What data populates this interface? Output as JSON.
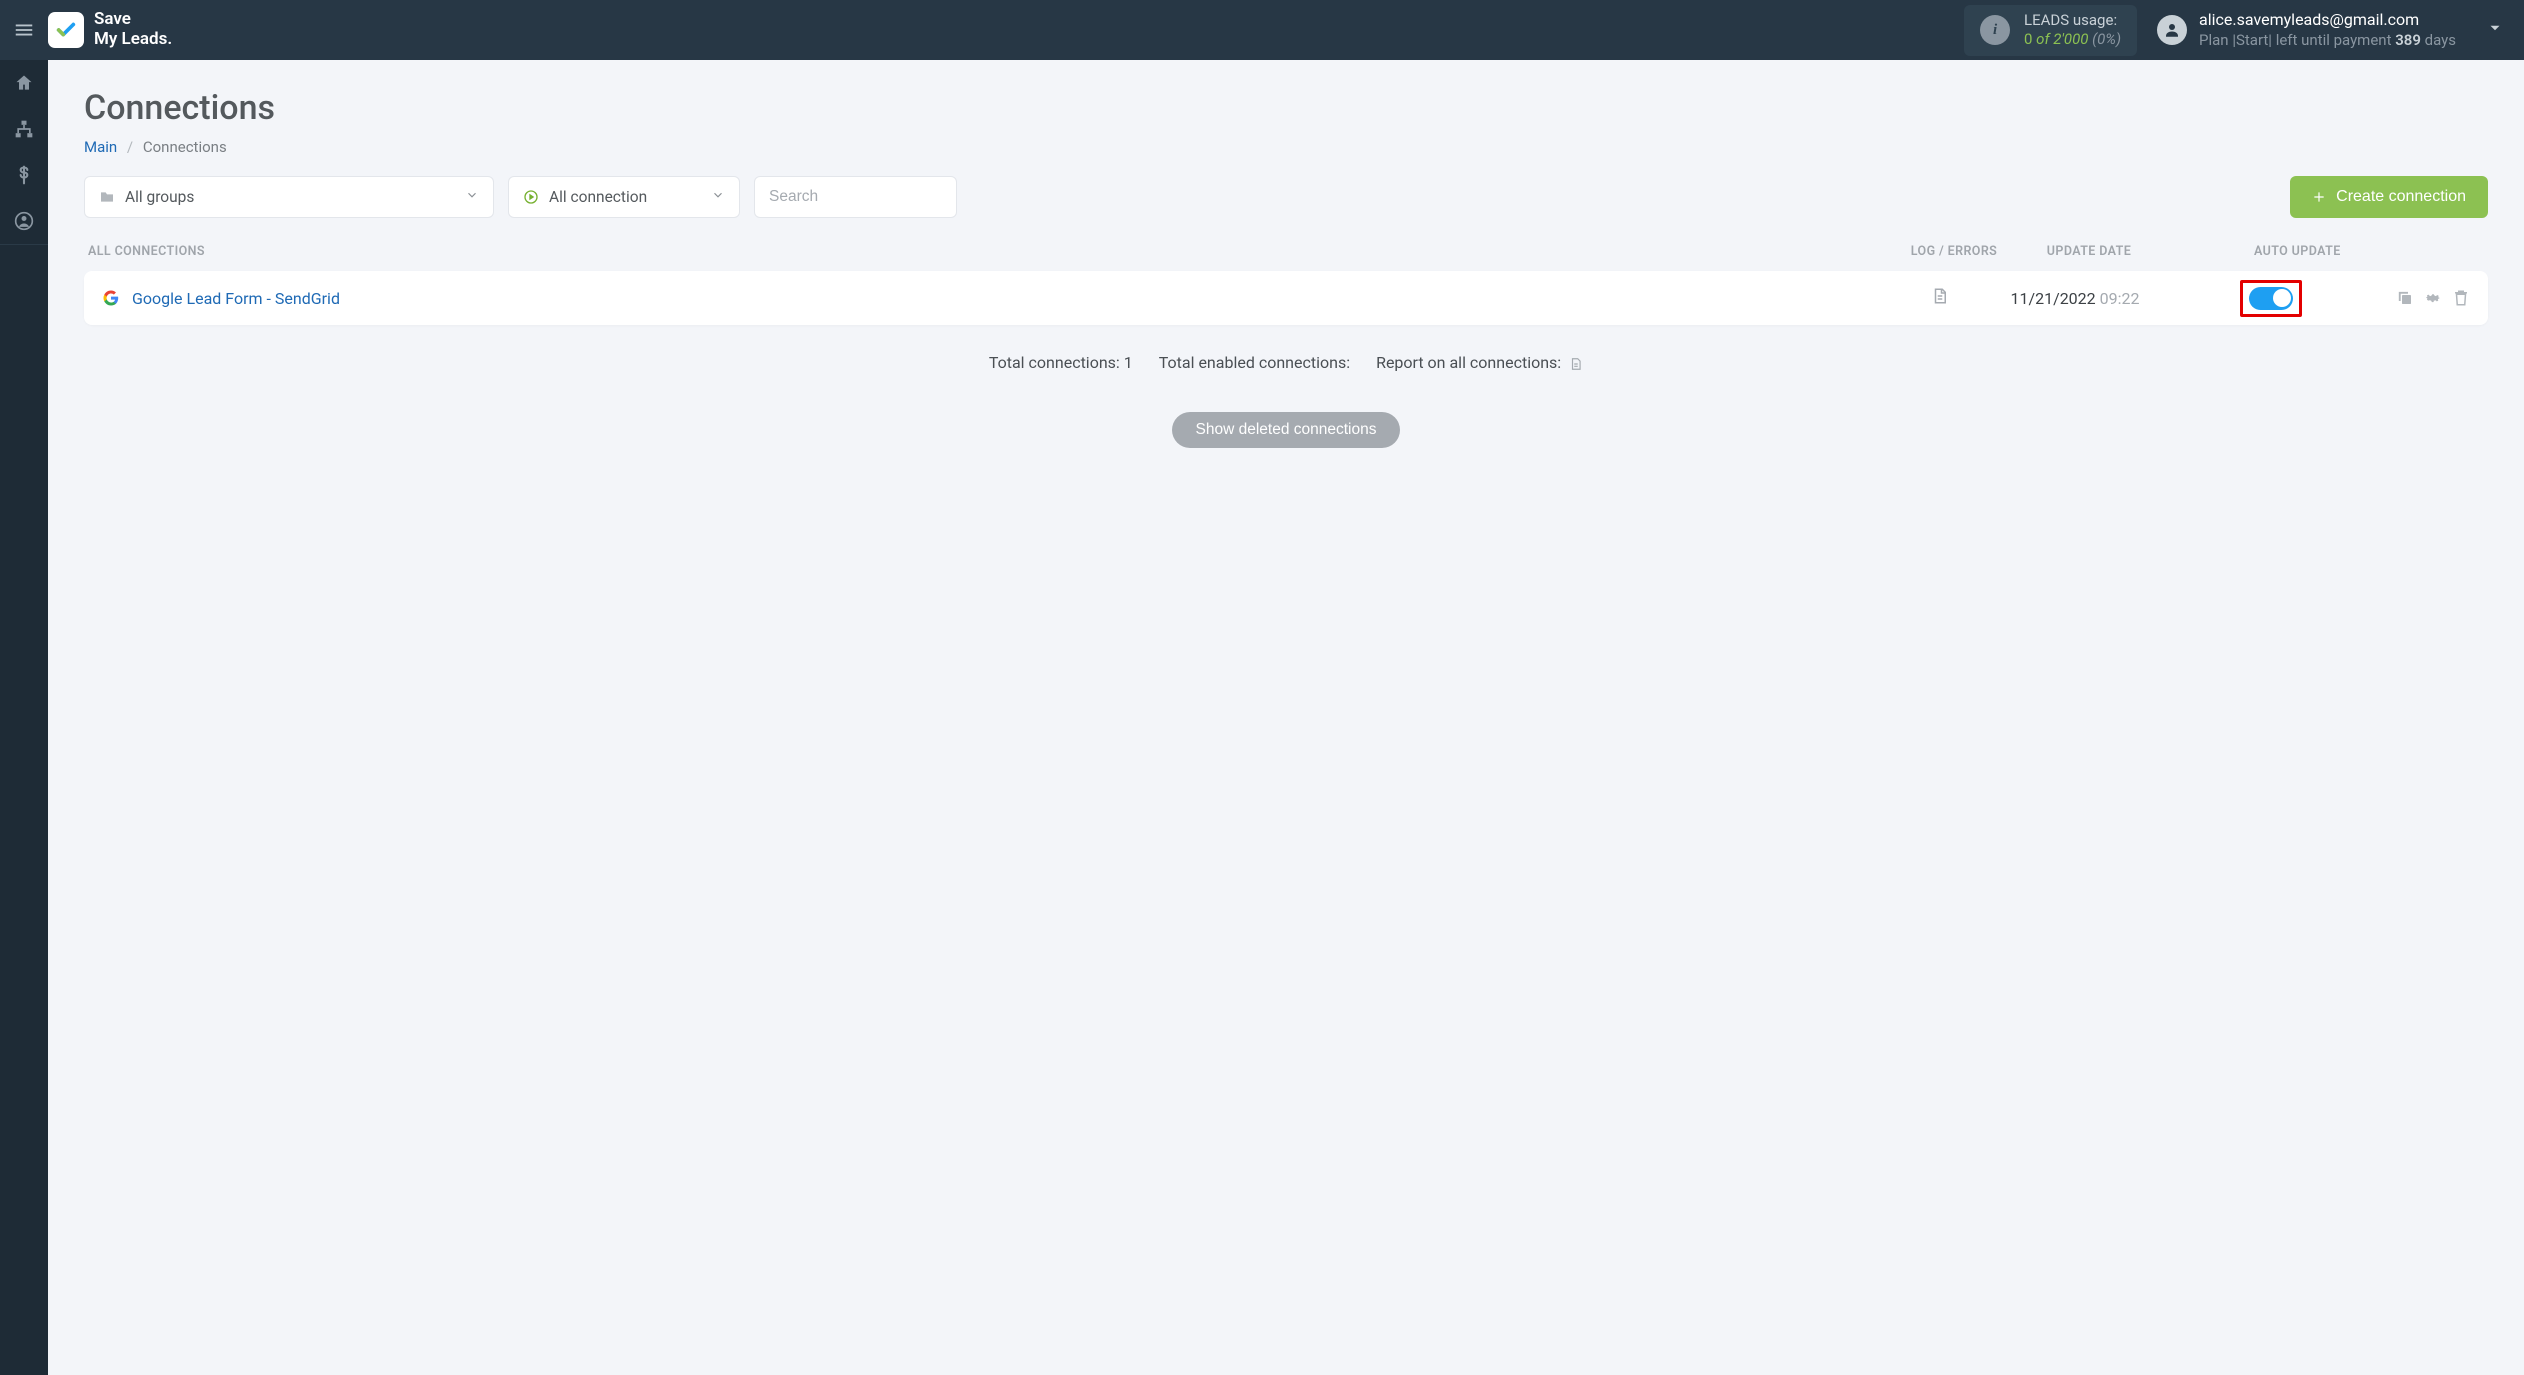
{
  "header": {
    "logo_line1": "Save",
    "logo_line2": "My Leads.",
    "leads_label": "LEADS usage:",
    "leads_used": "0",
    "leads_of": "of",
    "leads_total": "2'000",
    "leads_pct": "(0%)",
    "user_email": "alice.savemyleads@gmail.com",
    "user_plan_prefix": "Plan ",
    "user_plan_name": "|Start|",
    "user_plan_mid": " left until payment ",
    "user_plan_days": "389",
    "user_plan_suffix": " days"
  },
  "page": {
    "title": "Connections",
    "breadcrumb_main": "Main",
    "breadcrumb_current": "Connections"
  },
  "controls": {
    "groups": "All groups",
    "connection_filter": "All connection",
    "search_placeholder": "Search",
    "create_btn": "Create connection"
  },
  "table_header": {
    "all": "ALL CONNECTIONS",
    "log": "LOG / ERRORS",
    "date": "UPDATE DATE",
    "auto": "AUTO UPDATE"
  },
  "row": {
    "name": "Google Lead Form - SendGrid",
    "date": "11/21/2022",
    "time": "09:22"
  },
  "summary": {
    "total": "Total connections: 1",
    "enabled": "Total enabled connections:",
    "report": "Report on all connections:"
  },
  "show_deleted": "Show deleted connections"
}
